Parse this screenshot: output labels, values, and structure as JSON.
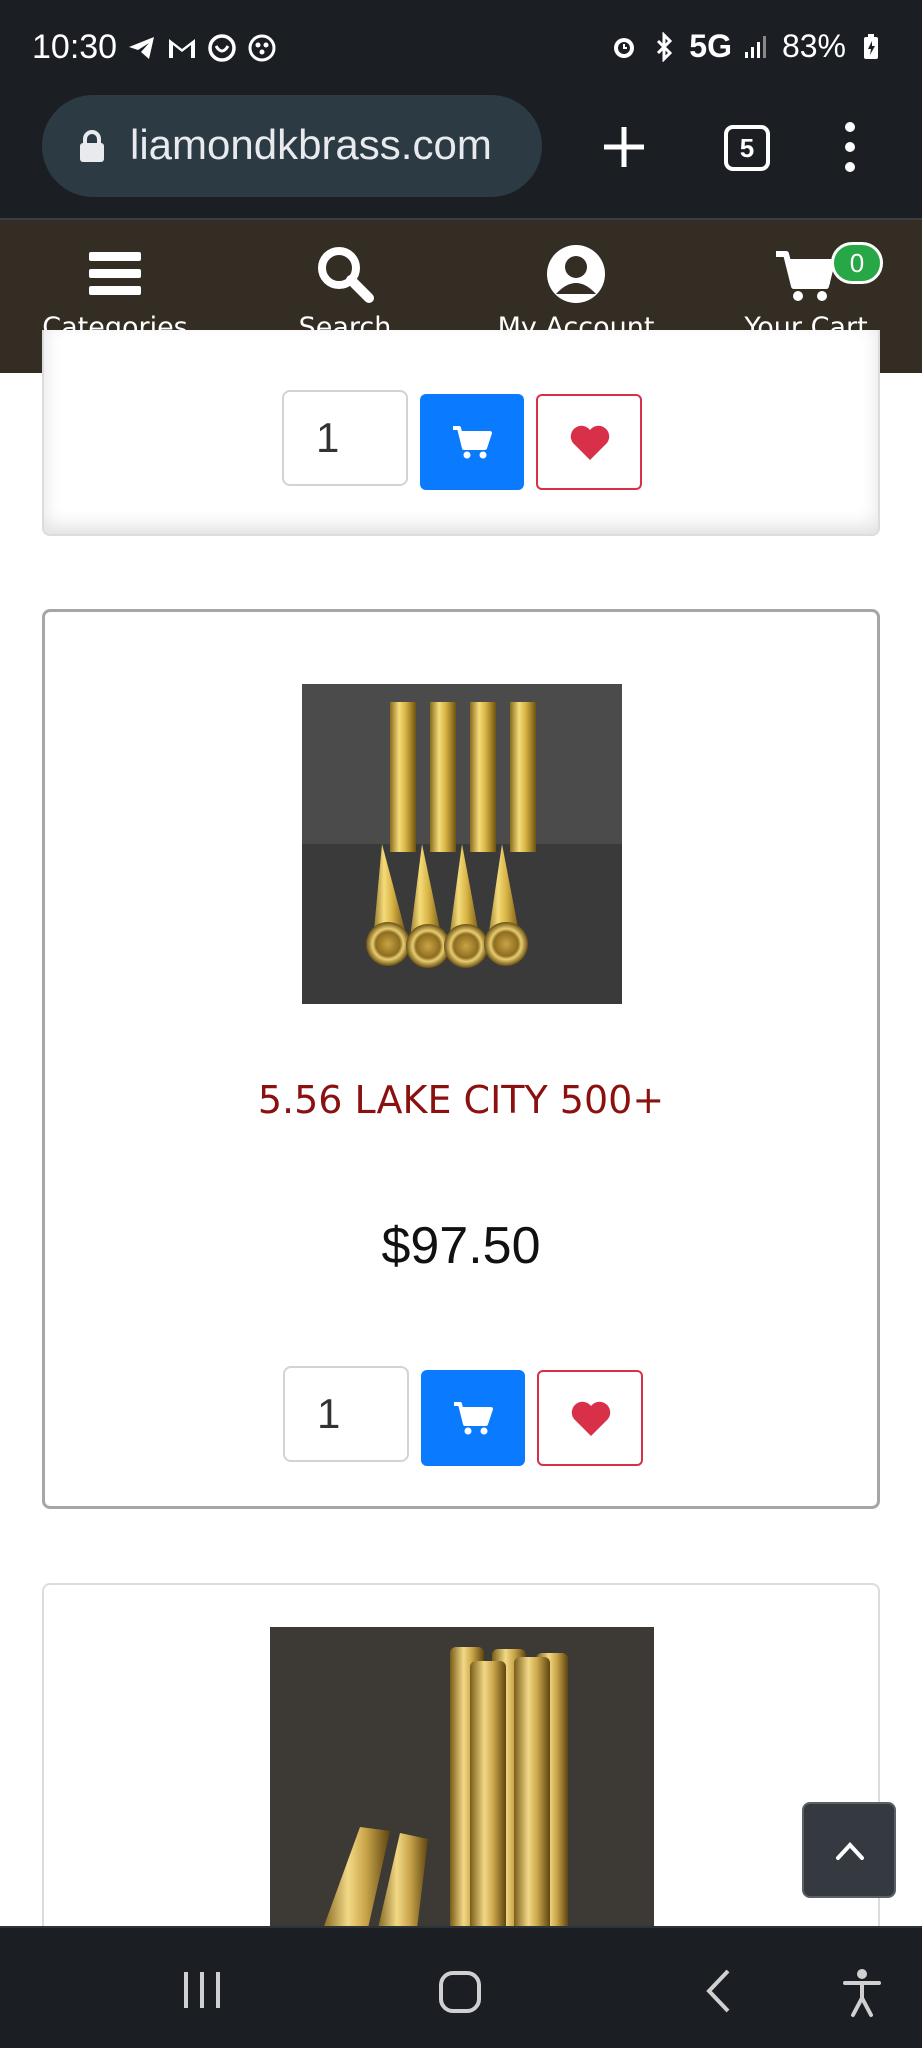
{
  "status_bar": {
    "time": "10:30",
    "network": "5G",
    "battery": "83%",
    "notification_icons": [
      "telegram-icon",
      "gmail-icon",
      "messenger-icon",
      "app-icon"
    ],
    "system_icons": [
      "alarm-icon",
      "bluetooth-icon",
      "signal-icon",
      "battery-icon"
    ]
  },
  "browser": {
    "url": "liamondkbrass.com",
    "tab_count": "5"
  },
  "site_nav": {
    "items": [
      {
        "label": "Categories",
        "icon": "hamburger-icon"
      },
      {
        "label": "Search",
        "icon": "search-icon"
      },
      {
        "label": "My Account",
        "icon": "account-icon"
      },
      {
        "label": "Your Cart",
        "icon": "cart-icon"
      }
    ],
    "cart_count": "0"
  },
  "products": [
    {
      "quantity": "1"
    },
    {
      "title": "5.56 LAKE CITY 500+",
      "price": "$97.50",
      "quantity": "1"
    },
    {}
  ],
  "colors": {
    "site_nav_bg": "#342d24",
    "cart_button": "#0a7bff",
    "wishlist_border": "#d9304a",
    "title": "#8b1010",
    "badge": "#27a745"
  }
}
